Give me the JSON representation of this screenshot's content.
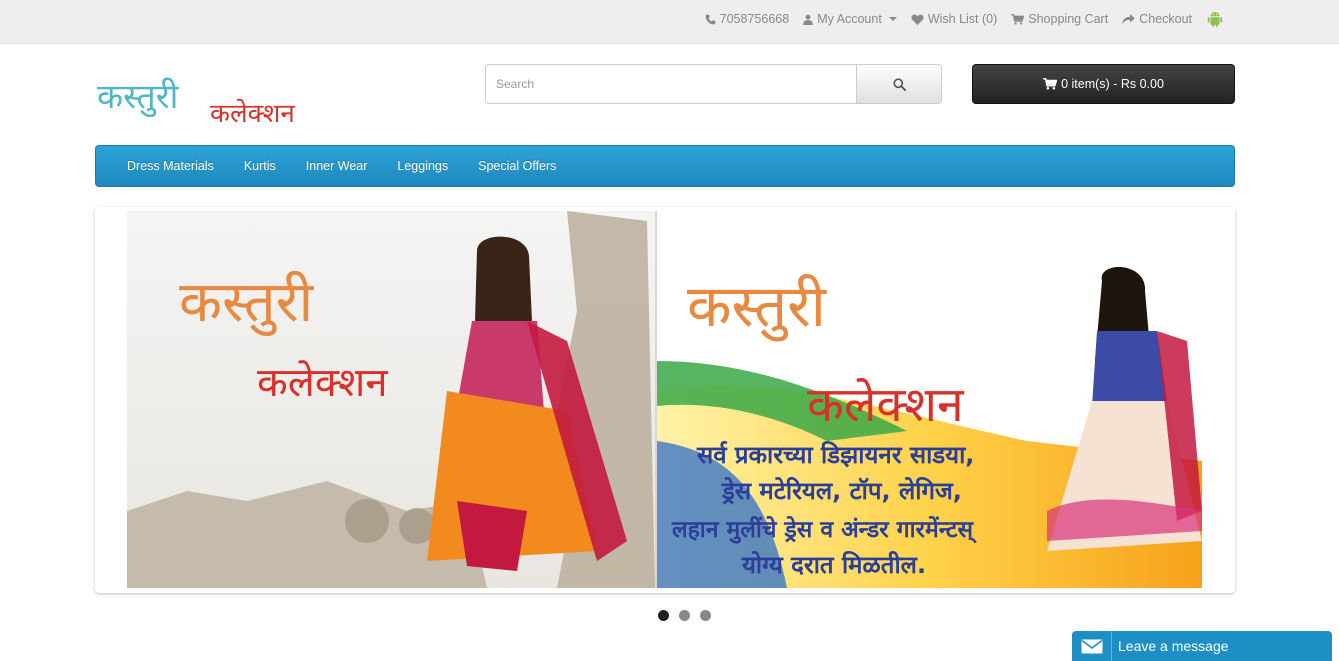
{
  "topbar": {
    "phone": "7058756668",
    "my_account": "My Account",
    "wish_list": "Wish List (0)",
    "shopping_cart": "Shopping Cart",
    "checkout": "Checkout"
  },
  "logo": {
    "line1": "कस्तुरी",
    "line2": "कलेक्शन"
  },
  "search": {
    "placeholder": "Search"
  },
  "cart": {
    "label": "0 item(s) - Rs 0.00"
  },
  "menu": {
    "items": [
      "Dress Materials",
      "Kurtis",
      "Inner Wear",
      "Leggings",
      "Special Offers"
    ]
  },
  "banner": {
    "left_line1": "कस्तुरी",
    "left_line2": "कलेक्शन",
    "right_line1": "कस्तुरी",
    "right_line2": "कलेक्शन",
    "right_text1": "सर्व प्रकारच्या डिझायनर साडया,",
    "right_text2": "ड्रेस मटेरियल, टॉप, लेगिज,",
    "right_text3": "लहान मुलींचे ड्रेस व अंन्डर गारमेंन्टस्",
    "right_text4": "योग्य दरात मिळतील."
  },
  "slideshow": {
    "current": 1,
    "total": 3
  },
  "chat": {
    "label": "Leave a message"
  },
  "colors": {
    "menu": "#2596cc",
    "cart": "#2d2d2d",
    "chat": "#1e8fc4",
    "logo_teal": "#4fb8c4",
    "logo_orange": "#e57f3a",
    "logo_red": "#d9302a"
  }
}
